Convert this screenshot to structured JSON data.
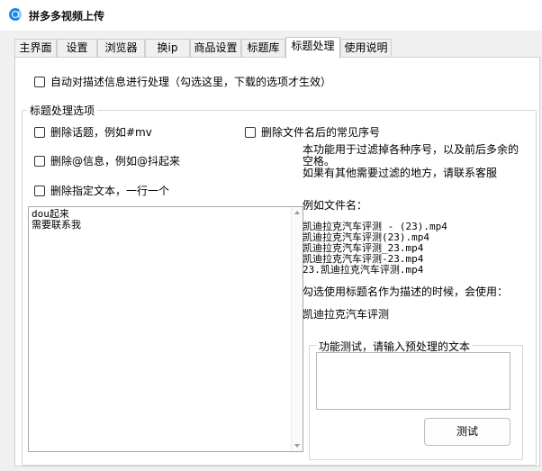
{
  "window": {
    "title": "拼多多视频上传"
  },
  "tabs": [
    {
      "label": "主界面"
    },
    {
      "label": "设置"
    },
    {
      "label": "浏览器"
    },
    {
      "label": "换ip"
    },
    {
      "label": "商品设置"
    },
    {
      "label": "标题库"
    },
    {
      "label": "标题处理"
    },
    {
      "label": "使用说明"
    }
  ],
  "active_tab": "标题处理",
  "options": {
    "process_description": "自动对描述信息进行处理（勾选这里，下载的选项才生效）"
  },
  "group": {
    "title": "标题处理选项",
    "remove_topic": "删除话题，例如#mv",
    "remove_mention": "删除@信息，例如@抖起来",
    "remove_text": "删除指定文本，一行一个",
    "remove_seq": "删除文件名后的常见序号",
    "text_lines": [
      "dou起来",
      "需要联系我"
    ],
    "info_line1": "本功能用于过滤掉各种序号，以及前后多余的",
    "info_line2": "空格。",
    "info_line3": "如果有其他需要过滤的地方，请联系客服",
    "example_label": "例如文件名：",
    "examples": [
      "凯迪拉克汽车评测 - (23).mp4",
      "凯迪拉克汽车评测(23).mp4",
      "凯迪拉克汽车评测_23.mp4",
      "凯迪拉克汽车评测-23.mp4",
      "23.凯迪拉克汽车评测.mp4"
    ],
    "usage_note": "勾选使用标题名作为描述的时候，会使用：",
    "result": "凯迪拉克汽车评测"
  },
  "test": {
    "title": "功能测试，请输入预处理的文本",
    "input_value": "",
    "button_label": "测试"
  }
}
